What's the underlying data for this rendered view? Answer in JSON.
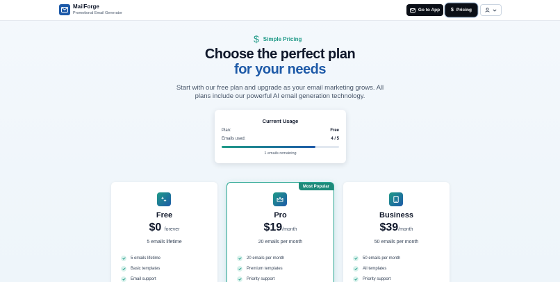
{
  "header": {
    "brand_name": "MailForge",
    "brand_tagline": "Promotional Email Generator",
    "go_to_app_label": "Go to App",
    "pricing_label": "Pricing"
  },
  "hero": {
    "eyebrow": "Simple Pricing",
    "title_line1": "Choose the perfect plan",
    "title_line2": "for your needs",
    "lead": "Start with our free plan and upgrade as your email marketing grows. All plans include our powerful AI email generation technology."
  },
  "usage": {
    "title": "Current Usage",
    "plan_label": "Plan:",
    "plan_value": "Free",
    "emails_label": "Emails used:",
    "emails_value": "4 / 5",
    "progress_fraction": 0.8,
    "remaining_text": "1 emails remaining"
  },
  "plans": [
    {
      "name": "Free",
      "price": "$0",
      "period": "forever",
      "emails": "5 emails lifetime",
      "icon": "sparkles-icon",
      "features": [
        "5 emails lifetime",
        "Basic templates",
        "Email support"
      ]
    },
    {
      "name": "Pro",
      "price": "$19",
      "period": "/month",
      "emails": "20 emails per month",
      "icon": "crown-icon",
      "badge": "Most Popular",
      "features": [
        "20 emails per month",
        "Premium templates",
        "Priority support"
      ]
    },
    {
      "name": "Business",
      "price": "$39",
      "period": "/month",
      "emails": "50 emails per month",
      "icon": "tablet-icon",
      "features": [
        "50 emails per month",
        "All templates",
        "Priority support"
      ]
    }
  ],
  "colors": {
    "primary": "#1e5aa8",
    "accent": "#1f9a87",
    "dark_button": "#0b0f17"
  }
}
